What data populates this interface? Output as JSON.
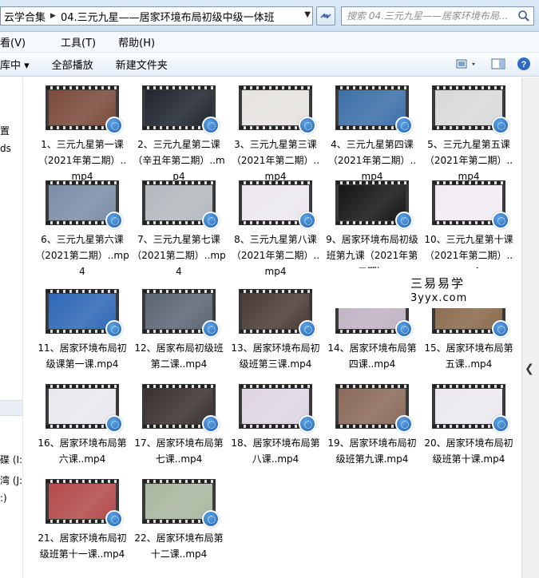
{
  "address_bar": {
    "segments": [
      "云学合集",
      "04.三元九星——居家环境布局初级中级一体班"
    ]
  },
  "search": {
    "placeholder": "搜索 04.三元九星——居家环境布局..."
  },
  "menu": {
    "items": [
      "看(V)",
      "工具(T)",
      "帮助(H)"
    ]
  },
  "toolbar": {
    "items": [
      "库中 ▾",
      "全部播放",
      "新建文件夹"
    ]
  },
  "nav_pane": {
    "items": [
      "置",
      "ds",
      "碟 (I:)",
      "湾 (J:",
      ":)"
    ]
  },
  "files": [
    {
      "label": "1、三元九星第一课（2021年第二期）..mp4",
      "thumb": "#7a4a3a"
    },
    {
      "label": "2、三元九星第二课（辛丑年第二期）..mp4",
      "thumb": "#20252e"
    },
    {
      "label": "3、三元九星第三课（2021年第二期）..mp4",
      "thumb": "#e6e3df"
    },
    {
      "label": "4、三元九星第四课（2021年第二期）..mp4",
      "thumb": "#3c6fa8"
    },
    {
      "label": "5、三元九星第五课（2021年第二期）..mp4",
      "thumb": "#d9d9dc"
    },
    {
      "label": "6、三元九星第六课（2021第二期）..mp4",
      "thumb": "#7a8ea6"
    },
    {
      "label": "7、三元九星第七课（2021第二期）..mp4",
      "thumb": "#b4b9bf"
    },
    {
      "label": "8、三元九星第八课（2021年第二期）..mp4",
      "thumb": "#ece7ef"
    },
    {
      "label": "9、居家环境布局初级班第九课（2021年第二期）",
      "thumb": "#151515"
    },
    {
      "label": "10、三元九星第十课（2021年第二期）..mp4",
      "thumb": "#f1ecf3"
    },
    {
      "label": "11、居家环境布局初级课第一课.mp4",
      "thumb": "#2f67b6"
    },
    {
      "label": "12、居家布局初级班第二课..mp4",
      "thumb": "#5b6674"
    },
    {
      "label": "13、居家环境布局初级班第三课.mp4",
      "thumb": "#4b3b35"
    },
    {
      "label": "14、居家环境布局第四课..mp4",
      "thumb": "#c0b2c3"
    },
    {
      "label": "15、居家环境布局第五课..mp4",
      "thumb": "#8a6a4c"
    },
    {
      "label": "16、居家环境布局第六课..mp4",
      "thumb": "#e8e8ee"
    },
    {
      "label": "17、居家环境布局第七课..mp4",
      "thumb": "#3a3030"
    },
    {
      "label": "18、居家环境布局第八课..mp4",
      "thumb": "#ded5e0"
    },
    {
      "label": "19、居家环境布局初级班第九课.mp4",
      "thumb": "#8a6a5a"
    },
    {
      "label": "20、居家环境布局初级班第十课.mp4",
      "thumb": "#ece9ee"
    },
    {
      "label": "21、居家环境布局初级班第十一课..mp4",
      "thumb": "#b34a4a"
    },
    {
      "label": "22、居家环境布局第十二课..mp4",
      "thumb": "#a9b79f"
    }
  ],
  "watermark": {
    "chinese": "三易易学",
    "url": "3yyx.com"
  },
  "colors": {
    "badge": "#2a6fc4",
    "address_bg": "#dce9f6"
  }
}
